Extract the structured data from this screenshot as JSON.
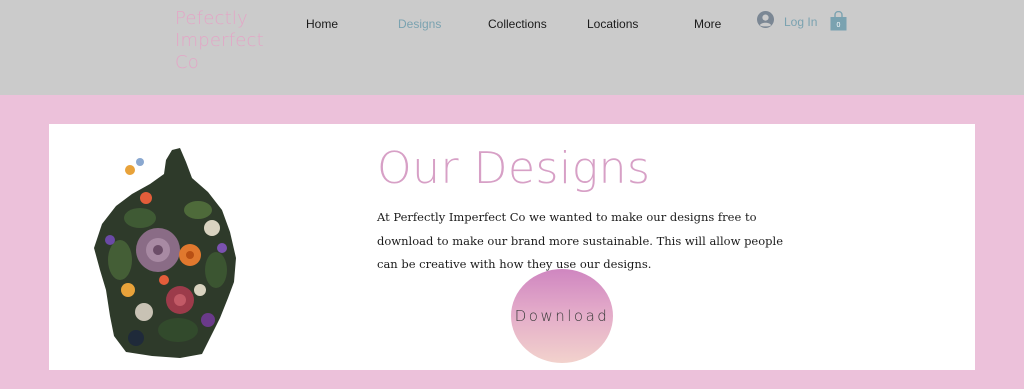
{
  "header": {
    "logo": "Pefectly Imperfect Co",
    "nav": {
      "home": "Home",
      "designs": "Designs",
      "collections": "Collections",
      "locations": "Locations",
      "more": "More"
    },
    "login_label": "Log In",
    "cart_count": "0",
    "colors": {
      "background": "#cbcbcb",
      "active_link": "#7aa2b0",
      "logo": "#e3a6c6"
    }
  },
  "main": {
    "title": "Our Designs",
    "description": "At Perfectly Imperfect Co we wanted to make our designs free to download to make our brand more sustainable. This will allow people can be creative with how they use our designs.",
    "download_label": "Download",
    "illustration_icon": "floral-torso-illustration",
    "colors": {
      "page_background": "#ecc1da",
      "title": "#d7a0c6"
    }
  }
}
